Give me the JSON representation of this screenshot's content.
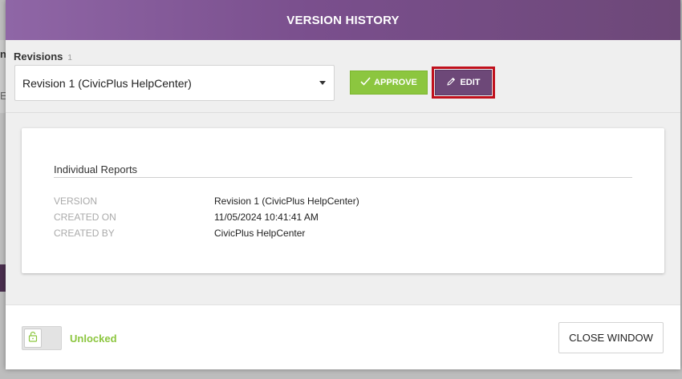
{
  "modal": {
    "title": "VERSION HISTORY"
  },
  "revisions": {
    "label": "Revisions",
    "count": "1",
    "selected": "Revision 1 (CivicPlus HelpCenter)"
  },
  "buttons": {
    "approve": "APPROVE",
    "edit": "EDIT",
    "close": "CLOSE WINDOW"
  },
  "report": {
    "title": "Individual Reports",
    "rows": [
      {
        "key": "VERSION",
        "value": "Revision 1 (CivicPlus HelpCenter)"
      },
      {
        "key": "CREATED ON",
        "value": "11/05/2024 10:41:41 AM"
      },
      {
        "key": "CREATED BY",
        "value": "CivicPlus HelpCenter"
      }
    ]
  },
  "lock": {
    "state": "Unlocked",
    "color": "#8cc63f"
  },
  "background": {
    "chars": [
      "n",
      "E"
    ]
  },
  "colors": {
    "header": "#7a4f8d",
    "approve": "#8cc63f",
    "edit": "#6d4878",
    "highlight": "#c0101c"
  }
}
